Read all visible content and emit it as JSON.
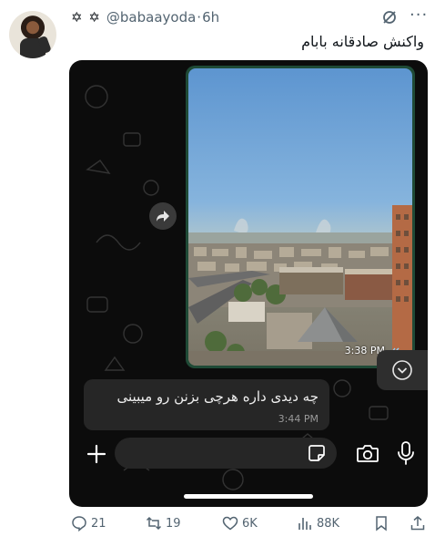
{
  "tweet": {
    "author_prefix": "✡ ✡",
    "handle": "@babaayoda",
    "separator": "·",
    "time": "6h",
    "text": "واکنش صادقانه بابام"
  },
  "chat": {
    "photo_time": "3:38 PM",
    "message_text": "چه دیدی داره هرچی بزنن رو میبینی",
    "message_time": "3:44 PM"
  },
  "engagement": {
    "replies": "21",
    "retweets": "19",
    "likes": "6K",
    "views": "88K"
  },
  "colors": {
    "accent_green": "#1f4a36",
    "chat_bg": "#0c0c0c",
    "muted": "#536471"
  },
  "icons": [
    "grok-icon",
    "more-icon",
    "forward-icon",
    "scroll-down-icon",
    "plus-icon",
    "sticker-icon",
    "camera-icon",
    "mic-icon",
    "reply-icon",
    "retweet-icon",
    "like-icon",
    "views-icon",
    "bookmark-icon",
    "share-icon"
  ]
}
